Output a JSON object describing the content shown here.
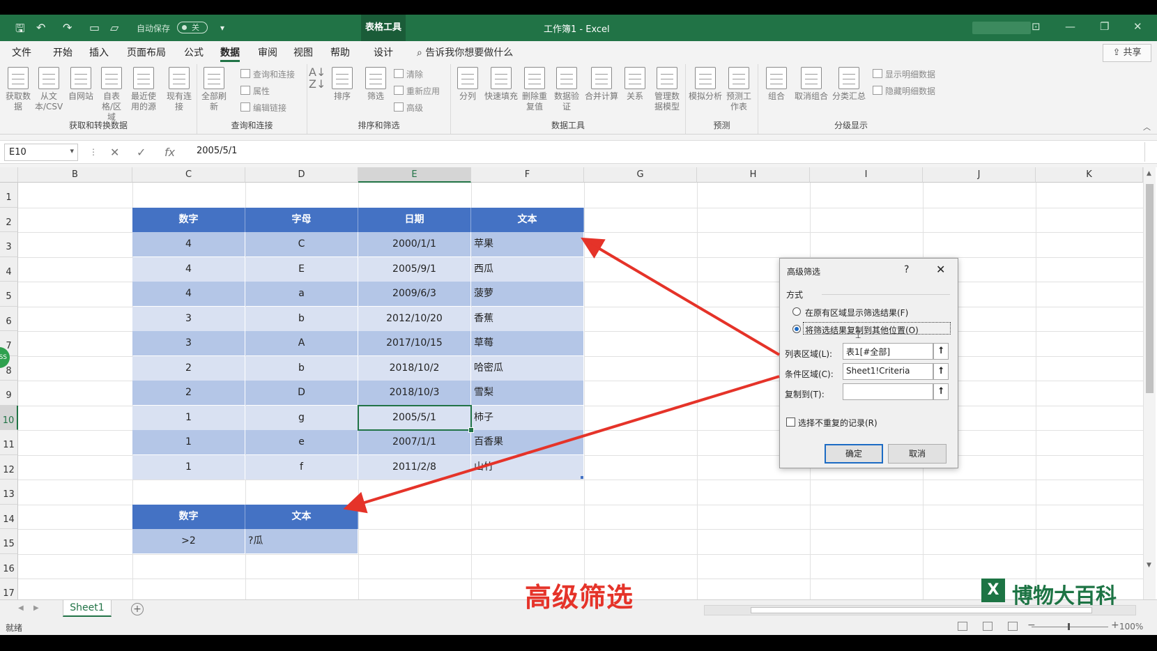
{
  "titlebar": {
    "autosave_label": "自动保存",
    "autosave_state": "关",
    "context_tab": "表格工具",
    "doc_title": "工作簿1 - Excel"
  },
  "menu": {
    "tabs": [
      "文件",
      "开始",
      "插入",
      "页面布局",
      "公式",
      "数据",
      "审阅",
      "视图",
      "帮助",
      "设计"
    ],
    "active": "数据",
    "search": "告诉我你想要做什么",
    "share": "共享"
  },
  "ribbon": {
    "groups": [
      {
        "label": "获取和转换数据",
        "buttons": [
          "获取数据",
          "从文本/CSV",
          "自网站",
          "自表格/区域",
          "最近使用的源"
        ]
      },
      {
        "label": "",
        "buttons": [
          "现有连接"
        ]
      },
      {
        "label": "查询和连接",
        "buttons": [
          "全部刷新"
        ],
        "small": [
          "查询和连接",
          "属性",
          "编辑链接"
        ]
      },
      {
        "label": "排序和筛选",
        "buttons": [
          "排序",
          "筛选"
        ],
        "small": [
          "清除",
          "重新应用",
          "高级"
        ]
      },
      {
        "label": "数据工具",
        "buttons": [
          "分列",
          "快速填充",
          "删除重复值",
          "数据验证",
          "合并计算",
          "关系",
          "管理数据模型"
        ]
      },
      {
        "label": "预测",
        "buttons": [
          "模拟分析",
          "预测工作表"
        ]
      },
      {
        "label": "分级显示",
        "buttons": [
          "组合",
          "取消组合",
          "分类汇总"
        ],
        "small": [
          "显示明细数据",
          "隐藏明细数据"
        ]
      }
    ]
  },
  "formula": {
    "namebox": "E10",
    "value": "2005/5/1"
  },
  "grid": {
    "columns": [
      "B",
      "C",
      "D",
      "E",
      "F",
      "G",
      "H",
      "I",
      "J",
      "K"
    ],
    "selected_col": "E",
    "rows": [
      "1",
      "2",
      "3",
      "4",
      "5",
      "6",
      "7",
      "8",
      "9",
      "10",
      "11",
      "12",
      "13",
      "14",
      "15",
      "16",
      "17"
    ],
    "selected_row": "10"
  },
  "table": {
    "headers": [
      "数字",
      "字母",
      "日期",
      "文本"
    ],
    "rows": [
      [
        "4",
        "C",
        "2000/1/1",
        "苹果"
      ],
      [
        "4",
        "E",
        "2005/9/1",
        "西瓜"
      ],
      [
        "4",
        "a",
        "2009/6/3",
        "菠萝"
      ],
      [
        "3",
        "b",
        "2012/10/20",
        "香蕉"
      ],
      [
        "3",
        "A",
        "2017/10/15",
        "草莓"
      ],
      [
        "2",
        "b",
        "2018/10/2",
        "哈密瓜"
      ],
      [
        "2",
        "D",
        "2018/10/3",
        "雪梨"
      ],
      [
        "1",
        "g",
        "2005/5/1",
        "柿子"
      ],
      [
        "1",
        "e",
        "2007/1/1",
        "百香果"
      ],
      [
        "1",
        "f",
        "2011/2/8",
        "山竹"
      ]
    ]
  },
  "criteria": {
    "headers": [
      "数字",
      "文本"
    ],
    "row": [
      ">2",
      "?瓜"
    ]
  },
  "dialog": {
    "title": "高级筛选",
    "help": "?",
    "method": "方式",
    "option1": "在原有区域显示筛选结果(F)",
    "option2": "将筛选结果复制到其他位置(O)",
    "list_label": "列表区域(L):",
    "list_value": "表1[#全部]",
    "criteria_label": "条件区域(C):",
    "criteria_value": "Sheet1!Criteria",
    "copy_label": "复制到(T):",
    "copy_value": "",
    "unique_label": "选择不重复的记录(R)",
    "ok": "确定",
    "cancel": "取消"
  },
  "sheet": {
    "tab": "Sheet1",
    "status": "就绪",
    "zoom": "100%"
  },
  "overlay": {
    "caption": "高级筛选",
    "brand": "博物大百科",
    "accent": "#e53329",
    "excel_green": "#217346",
    "table_header": "#4472c4",
    "band_dark": "#b4c6e7",
    "band_light": "#d9e1f2"
  }
}
